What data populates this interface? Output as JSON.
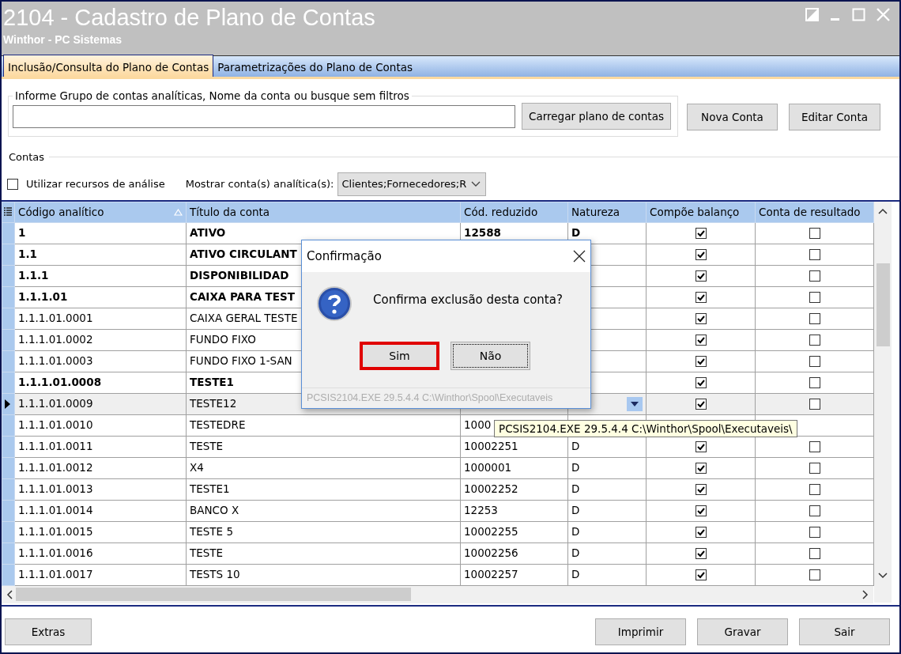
{
  "window": {
    "title": "2104 - Cadastro de Plano de Contas",
    "subtitle": "Winthor - PC Sistemas"
  },
  "tabs": [
    {
      "label": "Inclusão/Consulta do Plano de Contas",
      "selected": true
    },
    {
      "label": "Parametrizações do Plano de Contas",
      "selected": false
    }
  ],
  "filter": {
    "legend": "Informe Grupo de contas analíticas, Nome da conta ou busque sem filtros",
    "load_button": "Carregar plano de contas"
  },
  "actions": [
    "Nova Conta",
    "Editar Conta"
  ],
  "contas": {
    "legend": "Contas",
    "analysis_checkbox": {
      "label": "Utilizar recursos de análise",
      "checked": false
    },
    "show_label": "Mostrar conta(s) analítica(s):",
    "show_value": "Clientes;Fornecedores;R"
  },
  "table": {
    "columns": [
      "Código analítico",
      "Título da conta",
      "Cód. reduzido",
      "Natureza",
      "Compõe balanço",
      "Conta de resultado"
    ],
    "rows": [
      {
        "code": "1",
        "title": "ATIVO",
        "reduced": "12588",
        "nature": "D",
        "bold": true,
        "selected": false,
        "balance": true,
        "result": false
      },
      {
        "code": "1.1",
        "title": "ATIVO CIRCULANT",
        "bold": true,
        "selected": false,
        "balance": true,
        "result": false
      },
      {
        "code": "1.1.1",
        "title": "DISPONIBILIDAD",
        "bold": true,
        "selected": false,
        "balance": true,
        "result": false
      },
      {
        "code": "1.1.1.01",
        "title": "CAIXA PARA TEST",
        "bold": true,
        "selected": false,
        "balance": true,
        "result": false
      },
      {
        "code": "1.1.1.01.0001",
        "title": "CAIXA GERAL TESTE",
        "bold": false,
        "selected": false,
        "balance": true,
        "result": false
      },
      {
        "code": "1.1.1.01.0002",
        "title": "FUNDO FIXO",
        "bold": false,
        "selected": false,
        "balance": true,
        "result": false
      },
      {
        "code": "1.1.1.01.0003",
        "title": "FUNDO FIXO 1-SAN",
        "bold": false,
        "selected": false,
        "balance": true,
        "result": false
      },
      {
        "code": "1.1.1.01.0008",
        "title": "TESTE1",
        "bold": true,
        "selected": false,
        "balance": true,
        "result": false
      },
      {
        "code": "1.1.1.01.0009",
        "title": "TESTE12",
        "bold": false,
        "selected": true,
        "editing": true,
        "balance": true,
        "result": false
      },
      {
        "code": "1.1.1.01.0010",
        "title": "TESTEDRE",
        "reduced": "1000",
        "bold": false,
        "selected": false
      },
      {
        "code": "1.1.1.01.0011",
        "title": "TESTE",
        "reduced": "10002251",
        "nature": "D",
        "bold": false,
        "selected": false,
        "balance": true,
        "result": false
      },
      {
        "code": "1.1.1.01.0012",
        "title": "X4",
        "reduced": "1000001",
        "nature": "D",
        "bold": false,
        "selected": false,
        "balance": true,
        "result": false
      },
      {
        "code": "1.1.1.01.0013",
        "title": "TESTE1",
        "reduced": "10002252",
        "nature": "D",
        "bold": false,
        "selected": false,
        "balance": true,
        "result": false
      },
      {
        "code": "1.1.1.01.0014",
        "title": "BANCO X",
        "reduced": "12253",
        "nature": "D",
        "bold": false,
        "selected": false,
        "balance": true,
        "result": false
      },
      {
        "code": "1.1.1.01.0015",
        "title": "TESTE 5",
        "reduced": "10002255",
        "nature": "D",
        "bold": false,
        "selected": false,
        "balance": true,
        "result": false
      },
      {
        "code": "1.1.1.01.0016",
        "title": "TESTE",
        "reduced": "10002256",
        "nature": "D",
        "bold": false,
        "selected": false,
        "balance": true,
        "result": false
      },
      {
        "code": "1.1.1.01.0017",
        "title": "TESTS 10",
        "reduced": "10002257",
        "nature": "D",
        "bold": false,
        "selected": false,
        "balance": true,
        "result": false
      }
    ]
  },
  "footer_buttons": [
    {
      "label": "Extras",
      "align_right": false
    },
    {
      "label": "Imprimir",
      "align_right": true
    },
    {
      "label": "Gravar",
      "align_right": true
    },
    {
      "label": "Sair",
      "align_right": true
    }
  ],
  "dialog": {
    "title": "Confirmação",
    "message": "Confirma exclusão desta conta?",
    "buttons": [
      {
        "label": "Sim",
        "highlighted": true
      },
      {
        "label": "Não",
        "highlighted": false
      }
    ],
    "footer": "PCSIS2104.EXE 29.5.4.4 C:\\Winthor\\Spool\\Executaveis"
  },
  "tooltip": "PCSIS2104.EXE 29.5.4.4 C:\\Winthor\\Spool\\Executaveis\\"
}
